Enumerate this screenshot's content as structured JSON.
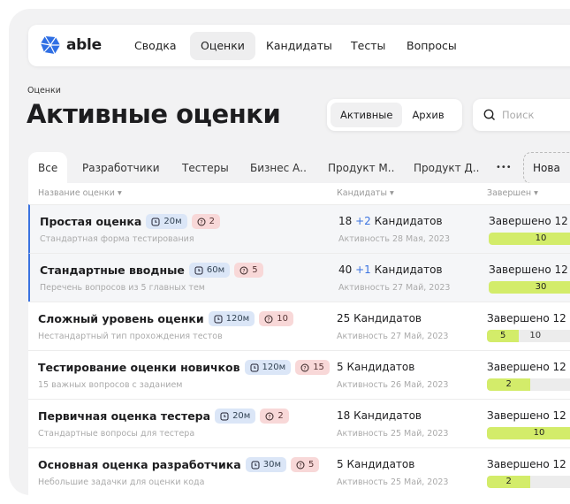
{
  "brand": {
    "name": "able",
    "accent": "#2f6fe4"
  },
  "nav": {
    "items": [
      "Сводка",
      "Оценки",
      "Кандидаты",
      "Тесты",
      "Вопросы"
    ],
    "active": 1
  },
  "breadcrumb": "Оценки",
  "title": "Активные оценки",
  "toggle": {
    "options": [
      "Активные",
      "Архив"
    ],
    "active": 0
  },
  "search": {
    "placeholder": "Поиск",
    "icon": "search-icon"
  },
  "tabs": {
    "items": [
      "Все",
      "Разработчики",
      "Тестеры",
      "Бизнес А..",
      "Продукт М..",
      "Продукт Д..",
      "•••"
    ],
    "new_label": "Нова"
  },
  "table": {
    "headers": [
      "Название оценки",
      "Кандидаты",
      "Завершен"
    ],
    "rows": [
      {
        "name": "Простая оценка",
        "time": "20м",
        "questions": "2",
        "desc": "Стандартная форма тестирования",
        "count": "18",
        "plus": "+2",
        "cand_label": "Кандидатов",
        "activity": "Активность 28 Мая, 2023",
        "done": "Завершено 12",
        "fill_label": "10",
        "rest_label": "",
        "fill_pct": 100,
        "highlight": true
      },
      {
        "name": "Стандартные вводные",
        "time": "60м",
        "questions": "5",
        "desc": "Перечень вопросов из 5 главных тем",
        "count": "40",
        "plus": "+1",
        "cand_label": "Кандидатов",
        "activity": "Активность 27 Май, 2023",
        "done": "Завершено 12",
        "fill_label": "30",
        "rest_label": "",
        "fill_pct": 100,
        "highlight": true
      },
      {
        "name": "Сложный уровень оценки",
        "time": "120м",
        "questions": "10",
        "desc": "Нестандартный тип прохождения тестов",
        "count": "25",
        "plus": "",
        "cand_label": "Кандидатов",
        "activity": "Активность 27 Май, 2023",
        "done": "Завершено 12",
        "fill_label": "5",
        "rest_label": "10",
        "fill_pct": 28,
        "highlight": false
      },
      {
        "name": "Тестирование оценки новичков",
        "time": "120м",
        "questions": "15",
        "desc": "15 важных вопросов с заданием",
        "count": "5",
        "plus": "",
        "cand_label": "Кандидатов",
        "activity": "Активность 26 Май, 2023",
        "done": "Завершено 12",
        "fill_label": "2",
        "rest_label": "",
        "fill_pct": 38,
        "highlight": false
      },
      {
        "name": "Первичная оценка тестера",
        "time": "20м",
        "questions": "2",
        "desc": "Стандартные вопросы для тестера",
        "count": "18",
        "plus": "",
        "cand_label": "Кандидатов",
        "activity": "Активность 25 Май, 2023",
        "done": "Завершено 12",
        "fill_label": "10",
        "rest_label": "",
        "fill_pct": 100,
        "highlight": false
      },
      {
        "name": "Основная оценка разработчика",
        "time": "30м",
        "questions": "5",
        "desc": "Небольшие задачки для оценки кода",
        "count": "5",
        "plus": "",
        "cand_label": "Кандидатов",
        "activity": "Активность 25 Май, 2023",
        "done": "Завершено 12",
        "fill_label": "2",
        "rest_label": "",
        "fill_pct": 38,
        "highlight": false
      }
    ]
  }
}
